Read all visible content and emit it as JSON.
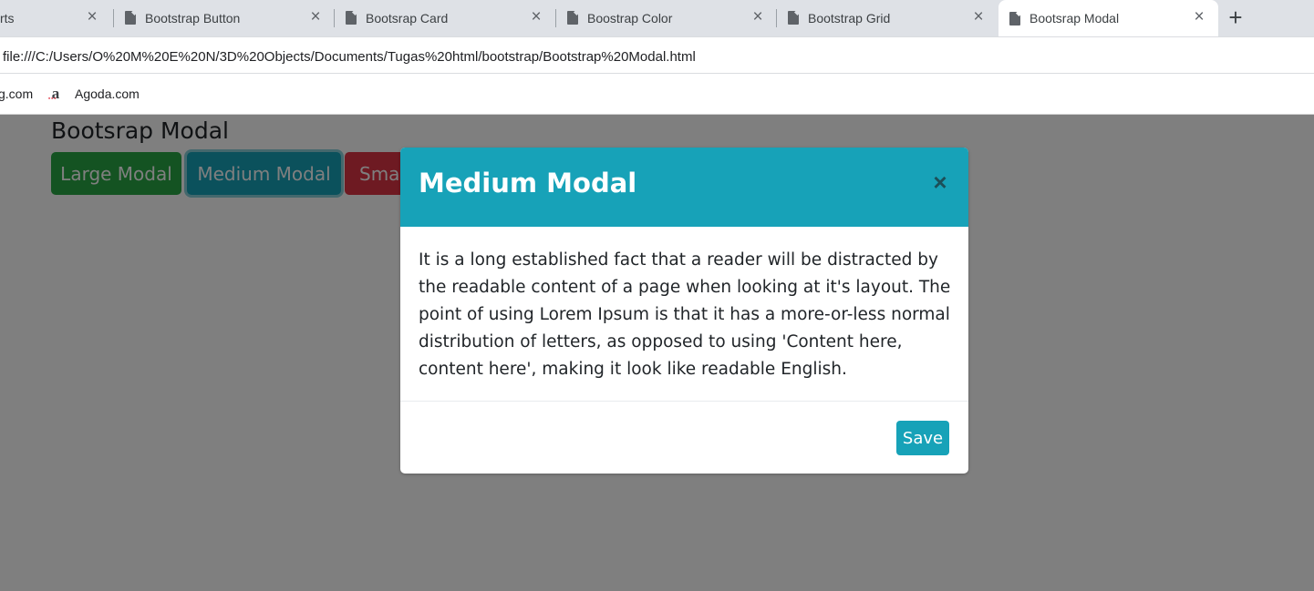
{
  "browser": {
    "tabs": [
      {
        "title": "rts",
        "active": false
      },
      {
        "title": "Bootstrap Button",
        "active": false
      },
      {
        "title": "Bootsrap Card",
        "active": false
      },
      {
        "title": "Boostrap Color",
        "active": false
      },
      {
        "title": "Bootstrap Grid",
        "active": false
      },
      {
        "title": "Bootsrap Modal",
        "active": true
      }
    ],
    "new_tab_label": "+",
    "close_glyph": "×",
    "url": "file:///C:/Users/O%20M%20E%20N/3D%20Objects/Documents/Tugas%20html/bootstrap/Bootstrap%20Modal.html",
    "bookmarks": [
      {
        "label": "g.com"
      },
      {
        "label": "Agoda.com",
        "icon": "agoda-icon",
        "icon_glyph": "a",
        "icon_dots": "•••"
      }
    ]
  },
  "page": {
    "title": "Bootsrap Modal",
    "buttons": {
      "large": "Large Modal",
      "medium": "Medium Modal",
      "small": "Small Modal"
    },
    "colors": {
      "success": "#28a745",
      "info": "#17a2b8",
      "danger": "#dc3545"
    }
  },
  "modal": {
    "title": "Medium Modal",
    "close_glyph": "×",
    "body": "It is a long established fact that a reader will be distracted by the readable content of a page when looking at it's layout. The point of using Lorem Ipsum is that it has a more-or-less normal distribution of letters, as opposed to using 'Content here, content here', making it look like readable English.",
    "save_label": "Save"
  }
}
